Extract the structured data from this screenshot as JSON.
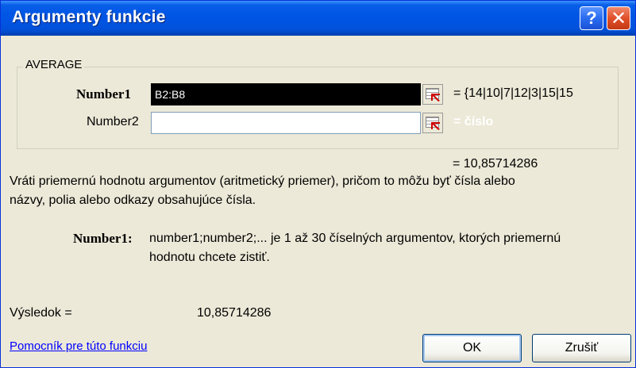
{
  "window": {
    "title": "Argumenty funkcie",
    "help_glyph": "?",
    "close_glyph": "✕"
  },
  "function": {
    "name": "AVERAGE",
    "args": [
      {
        "label": "Number1",
        "value": "B2:B8",
        "preview": "= {14|10|7|12|3|15|15"
      },
      {
        "label": "Number2",
        "value": "",
        "preview": "= číslo"
      }
    ],
    "result_preview": "= 10,85714286",
    "description": [
      "Vráti priemernú hodnotu argumentov (aritmetický priemer), pričom to môžu byť čísla alebo",
      "názvy, polia alebo odkazy obsahujúce čísla."
    ],
    "arg_help_label": "Number1:",
    "arg_help": [
      "number1;number2;... je 1 až 30 číselných argumentov, ktorých priemernú",
      "hodnotu chcete zistiť."
    ]
  },
  "result": {
    "label": "Výsledok =",
    "value": "10,85714286"
  },
  "footer": {
    "help_link": "Pomocník pre túto funkciu",
    "ok_label": "OK",
    "cancel_label": "Zrušiť"
  },
  "colors": {
    "titlebar": "#0054e3",
    "dialog_bg": "#ece9d8",
    "link": "#0000ff"
  }
}
